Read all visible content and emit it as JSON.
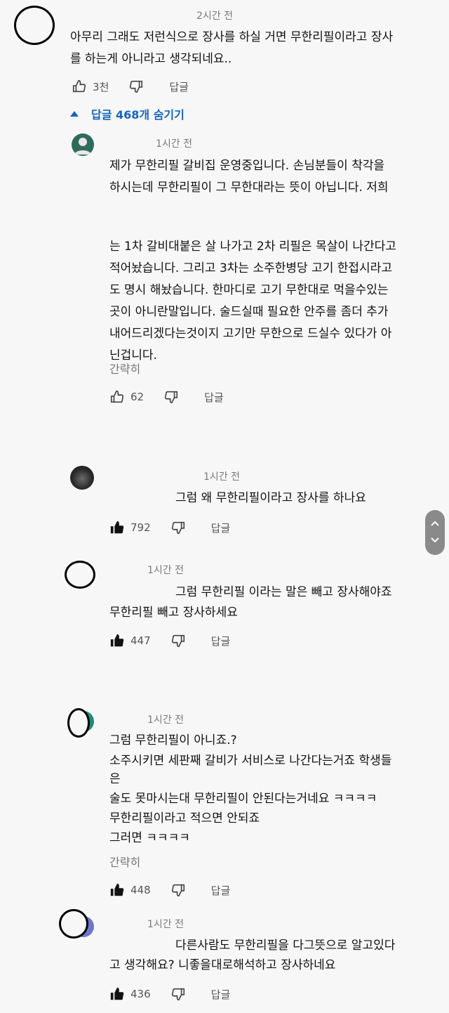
{
  "comment1": {
    "time": "2시간 전",
    "lines": [
      "아무리 그래도 저런식으로 장사를 하실 거면 무한리필이라고 장사",
      "를 하는게 아니라고 생각되네요.."
    ],
    "likes": "3천",
    "reply": "답글"
  },
  "replies_toggle": {
    "label": "답글 468개 숨기기"
  },
  "reply1": {
    "time": "1시간 전",
    "lines_a": [
      "제가 무한리필 갈비집 운영중입니다. 손님분들이 착각을",
      "하시는데 무한리필이 그 무한대라는 뜻이 아닙니다. 저희"
    ],
    "lines_b": [
      "는 1차 갈비대붙은 살 나가고 2차 리필은 목살이 나간다고",
      "적어놨습니다. 그리고 3차는 소주한병당 고기 한접시라고",
      "도 명시 해놨습니다. 한마디로 고기 무한대로 먹을수있는",
      "곳이 아니란말입니다. 술드실때 필요한 안주를 좀더 추가",
      "내어드리겠다는것이지 고기만 무한으로 드실수 있다가 아",
      "닌겁니다."
    ],
    "more": "간략히",
    "likes": "62",
    "reply": "답글"
  },
  "reply2": {
    "time": "1시간 전",
    "lines": [
      "그럼 왜 무한리필이라고 장사를 하나요"
    ],
    "likes": "792",
    "reply": "답글"
  },
  "reply3": {
    "time": "1시간 전",
    "lines": [
      "그럼 무한리필 이라는 말은 빼고 장사해야죠",
      "무한리필 빼고 장사하세요"
    ],
    "likes": "447",
    "reply": "답글"
  },
  "reply4": {
    "time": "1시간 전",
    "lines": [
      "그럼 무한리필이 아니죠.?",
      "소주시키면 세판째 갈비가 서비스로 나간다는거죠 학생들",
      "은",
      "술도 못마시는대 무한리필이 안된다는거네요 ㅋㅋㅋㅋ",
      "무한리필이라고 적으면 안되죠",
      "그러면 ㅋㅋㅋㅋ"
    ],
    "more": "간략히",
    "likes": "448",
    "reply": "답글"
  },
  "reply5": {
    "time": "1시간 전",
    "lines": [
      "다른사람도 무한리필을 다그뜻으로 알고있다",
      "고 생각해요? 니좋을대로해석하고 장사하네요"
    ],
    "likes": "436",
    "reply": "답글"
  },
  "colors": {
    "link_blue": "#1565c0",
    "scroll_pill": "#8a8a8a"
  }
}
